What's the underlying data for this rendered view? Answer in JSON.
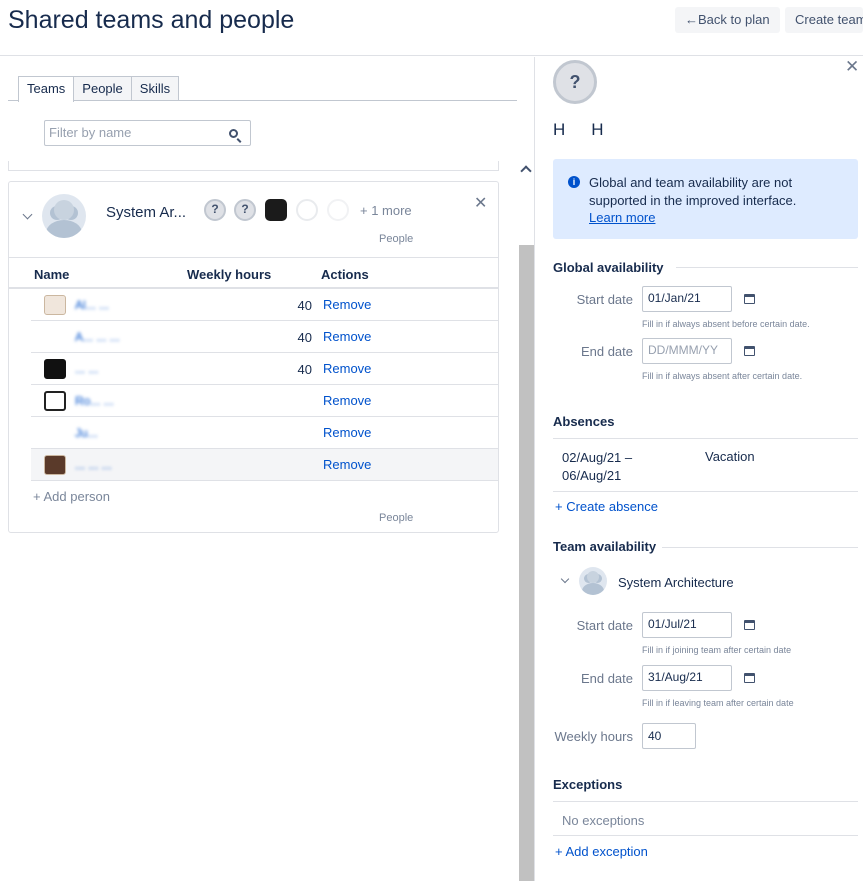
{
  "header": {
    "title": "Shared teams and people",
    "back_button": "←Back to plan",
    "create_button": "Create team"
  },
  "left": {
    "tabs": [
      "Teams",
      "People",
      "Skills"
    ],
    "filter_placeholder": "Filter by name",
    "team": {
      "name": "System Ar...",
      "more": "+ 1 more",
      "people_label": "People",
      "people_label_bottom": "People",
      "columns": [
        "Name",
        "Weekly hours",
        "Actions"
      ],
      "rows": [
        {
          "name": "Al... ...",
          "hours": "40",
          "action": "Remove"
        },
        {
          "name": "A... ... ...",
          "hours": "40",
          "action": "Remove"
        },
        {
          "name": "... ...",
          "hours": "40",
          "action": "Remove"
        },
        {
          "name": "Ro... ...",
          "hours": "",
          "action": "Remove"
        },
        {
          "name": "Ju...",
          "hours": "",
          "action": "Remove"
        },
        {
          "name": "... ... ...",
          "hours": "",
          "action": "Remove"
        }
      ],
      "add_person": "+ Add person"
    }
  },
  "right": {
    "avatar_glyph": "?",
    "user_name": "HH",
    "info": {
      "text": "Global and team availability are not supported in the improved interface.",
      "link": "Learn more"
    },
    "global": {
      "title": "Global availability",
      "start_label": "Start date",
      "start_value": "01/Jan/21",
      "start_hint": "Fill in if always absent before certain date.",
      "end_label": "End date",
      "end_placeholder": "DD/MMM/YY",
      "end_hint": "Fill in if always absent after certain date."
    },
    "absences": {
      "title": "Absences",
      "date_from": "02/Aug/21 –",
      "date_to": "06/Aug/21",
      "type": "Vacation",
      "create": "+ Create absence"
    },
    "team_availability": {
      "title": "Team availability",
      "team_name": "System Architecture",
      "start_label": "Start date",
      "start_value": "01/Jul/21",
      "start_hint": "Fill in if joining team after certain date",
      "end_label": "End date",
      "end_value": "31/Aug/21",
      "end_hint": "Fill in if leaving team after certain date",
      "hours_label": "Weekly hours",
      "hours_value": "40"
    },
    "exceptions": {
      "title": "Exceptions",
      "empty": "No exceptions",
      "add": "+ Add exception"
    }
  }
}
